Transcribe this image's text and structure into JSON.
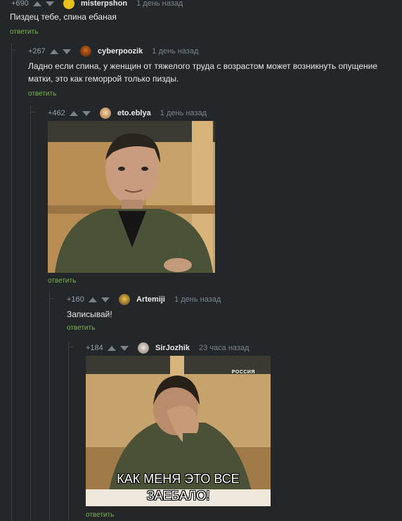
{
  "comments": [
    {
      "rating": "+690",
      "user": "misterpshon",
      "time": "1 день назад",
      "text": "Пиздец тебе, спина ебаная",
      "reply": "ответить"
    },
    {
      "rating": "+267",
      "user": "cyberpoozik",
      "time": "1 день назад",
      "text": "Ладно если спина, у женщин от тяжелого труда с возрастом может возникнуть опущение матки, это как геморрой только пизды.",
      "reply": "ответить"
    },
    {
      "rating": "+462",
      "user": "eto.eblya",
      "time": "1 день назад",
      "reply": "ответить"
    },
    {
      "rating": "+160",
      "user": "Artemiji",
      "time": "1 день назад",
      "text": "Записывай!",
      "reply": "ответить"
    },
    {
      "rating": "+184",
      "user": "SirJozhik",
      "time": "23 часа назад",
      "reply": "ответить",
      "image_caption_line1": "КАК МЕНЯ ЭТО ВСЕ",
      "image_caption_line2": "ЗАЕБАЛО!",
      "channel_logo": "РОССИЯ"
    }
  ],
  "colors": {
    "background": "#24272a",
    "reply": "#7bb04f",
    "thread": "#3b3f43"
  },
  "icons": {
    "vote_up": "up-arrow-icon",
    "vote_down": "down-arrow-icon"
  }
}
